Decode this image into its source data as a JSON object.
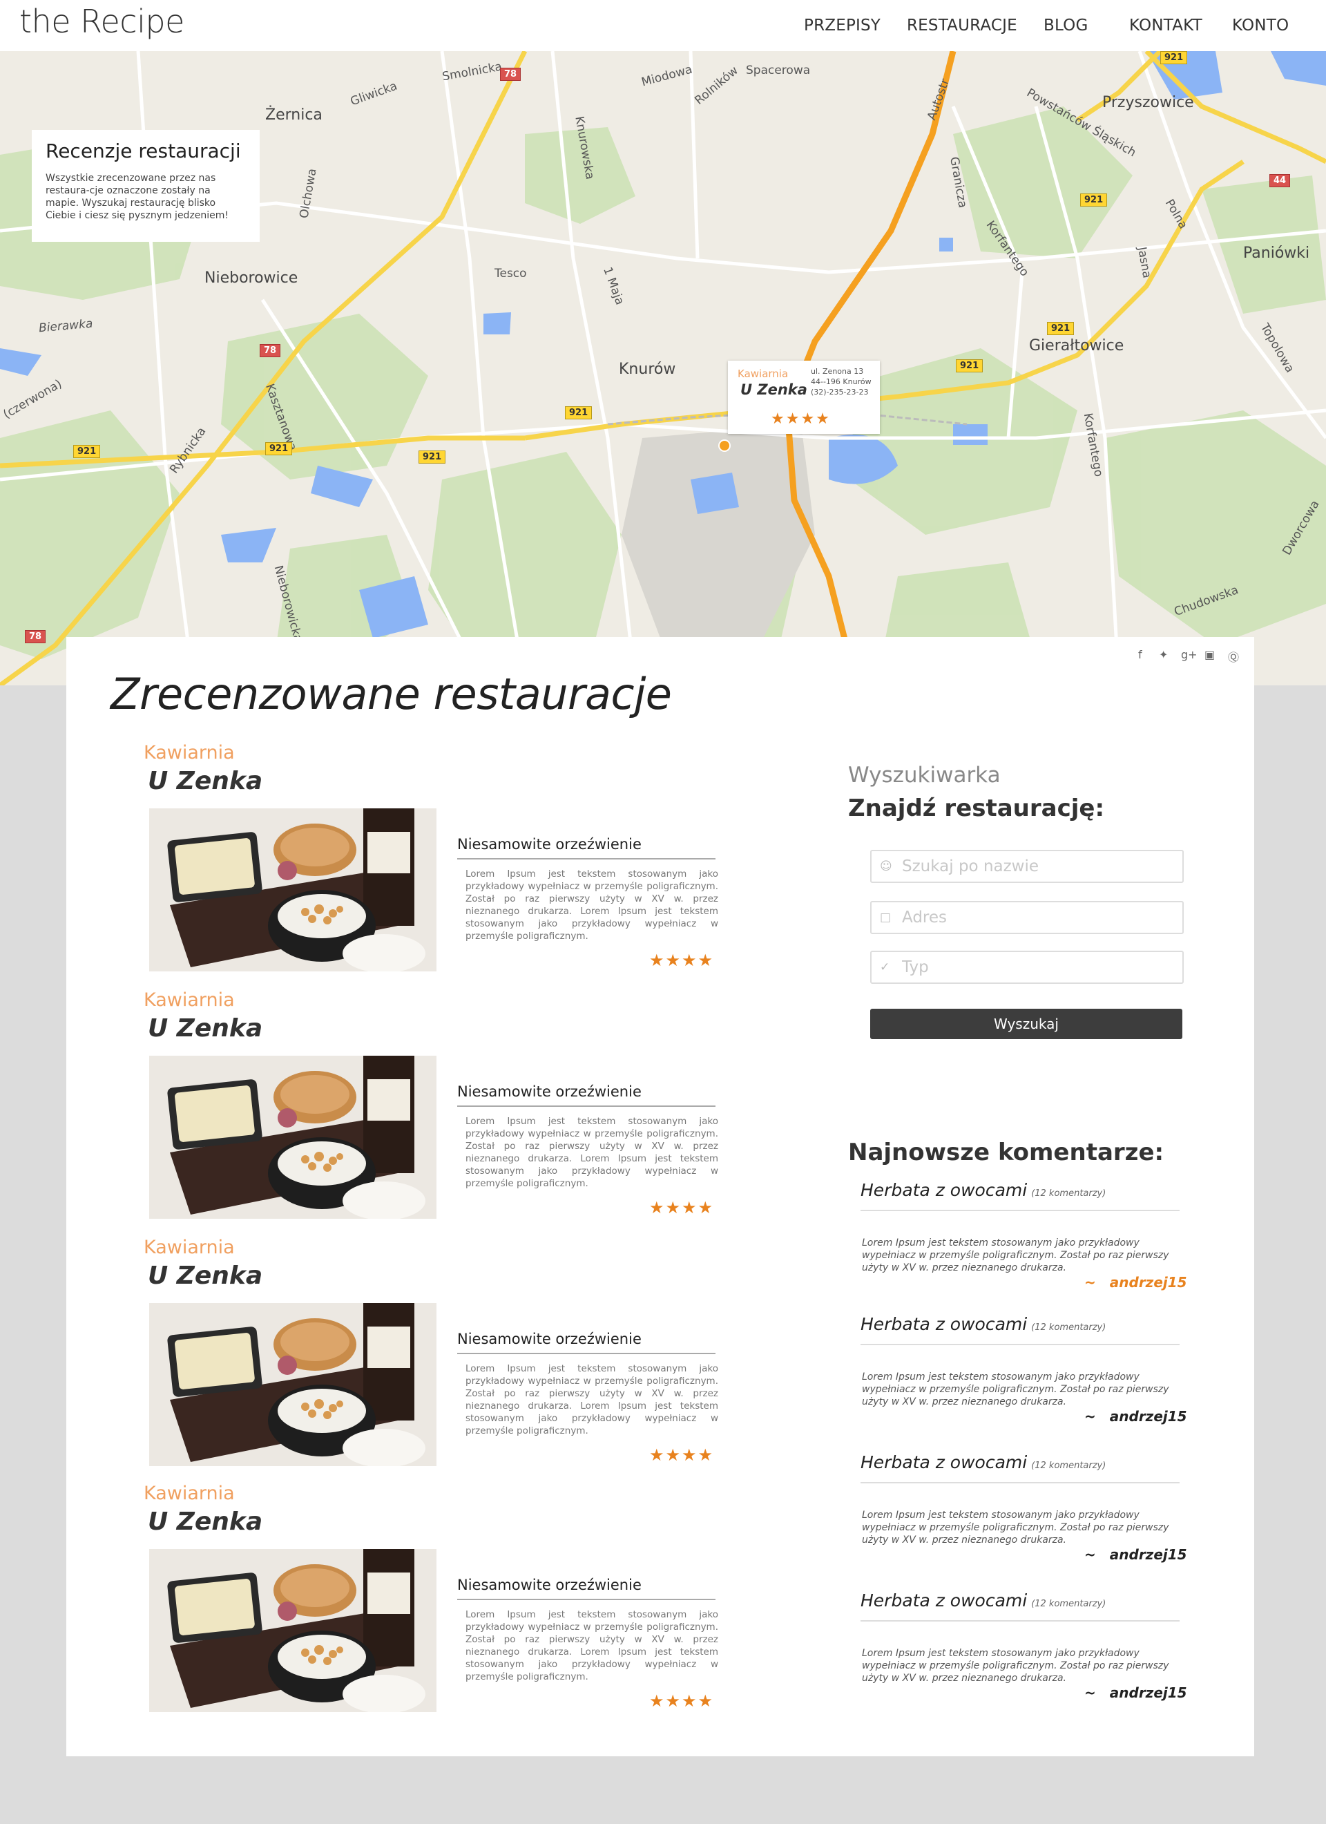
{
  "header": {
    "logo": "the Recipe",
    "nav": [
      "PRZEPISY",
      "RESTAURACJE",
      "BLOG",
      "KONTAKT",
      "KONTO"
    ]
  },
  "map": {
    "card_title": "Recenzje restauracji",
    "card_text": "Wszystkie zrecenzowane przez nas restaura-cje oznaczone zostały na mapie. Wyszukaj restaurację blisko Ciebie i ciesz się pysznym jedzeniem!",
    "labels": {
      "zernica": "Żernica",
      "nieborowice": "Nieborowice",
      "knurow": "Knurów",
      "przyszowice": "Przyszowice",
      "gieraltowice": "Gierałtowice",
      "paniowki": "Paniówki",
      "bierawka": "Bierawka",
      "tesco": "Tesco",
      "smolnicka": "Smolnicka",
      "gliwicka": "Gliwicka",
      "miodowa": "Miodowa",
      "rolnikow": "Rolników",
      "spacerowa": "Spacerowa",
      "knurowska": "Knurowska",
      "autostrada": "Autostr",
      "korfantego": "Korfantego",
      "chudowska": "Chudowska",
      "rybnicka": "Rybnicka",
      "olchowa": "Olchowa",
      "jasna": "Jasna",
      "polna": "Polna",
      "topolowa": "Topolowa",
      "dworcowa": "Dworcowa",
      "kasztanowa": "Kasztanowa",
      "nieborowicka": "Nieborowicka",
      "czerwona": "(czerwona)",
      "powstancow": "Powstańców Śląskich",
      "grunwaldzka": "Granicza",
      "maja": "1 Maja"
    },
    "road_numbers": {
      "r921": "921",
      "r78": "78",
      "r44": "44"
    },
    "pin": {
      "type": "Kawiarnia",
      "name": "U Zenka",
      "address_line1": "ul. Zenona 13",
      "address_line2": "44--196 Knurów",
      "phone": "(32)-235-23-23",
      "stars": "★★★★",
      "rating": 4
    }
  },
  "social_icons": [
    "facebook-icon",
    "twitter-icon",
    "google-plus-icon",
    "instagram-icon",
    "pinterest-icon"
  ],
  "main": {
    "title": "Zrecenzowane restauracje",
    "reviews": [
      {
        "type": "Kawiarnia",
        "name": "U Zenka",
        "headline": "Niesamowite orzeźwienie",
        "text": "Lorem Ipsum jest tekstem stosowanym jako przykładowy wypełniacz w przemyśle poligraficznym. Został po raz pierwszy użyty w XV w. przez nieznanego drukarza. Lorem Ipsum jest tekstem stosowanym jako przykładowy wypełniacz w przemyśle poligraficznym.",
        "stars": "★★★★",
        "rating": 4
      },
      {
        "type": "Kawiarnia",
        "name": "U Zenka",
        "headline": "Niesamowite orzeźwienie",
        "text": "Lorem Ipsum jest tekstem stosowanym jako przykładowy wypełniacz w przemyśle poligraficznym. Został po raz pierwszy użyty w XV w. przez nieznanego drukarza. Lorem Ipsum jest tekstem stosowanym jako przykładowy wypełniacz w przemyśle poligraficznym.",
        "stars": "★★★★",
        "rating": 4
      },
      {
        "type": "Kawiarnia",
        "name": "U Zenka",
        "headline": "Niesamowite orzeźwienie",
        "text": "Lorem Ipsum jest tekstem stosowanym jako przykładowy wypełniacz w przemyśle poligraficznym. Został po raz pierwszy użyty w XV w. przez nieznanego drukarza. Lorem Ipsum jest tekstem stosowanym jako przykładowy wypełniacz w przemyśle poligraficznym.",
        "stars": "★★★★",
        "rating": 4
      },
      {
        "type": "Kawiarnia",
        "name": "U Zenka",
        "headline": "Niesamowite orzeźwienie",
        "text": "Lorem Ipsum jest tekstem stosowanym jako przykładowy wypełniacz w przemyśle poligraficznym. Został po raz pierwszy użyty w XV w. przez nieznanego drukarza. Lorem Ipsum jest tekstem stosowanym jako przykładowy wypełniacz w przemyśle poligraficznym.",
        "stars": "★★★★",
        "rating": 4
      }
    ]
  },
  "sidebar": {
    "search_subtitle": "Wyszukiwarka",
    "search_title": "Znajdź restaurację:",
    "name_placeholder": "Szukaj po nazwie",
    "address_placeholder": "Adres",
    "type_placeholder": "Typ",
    "search_button": "Wyszukaj",
    "comments_title": "Najnowsze komentarze:",
    "comments": [
      {
        "title": "Herbata z owocami",
        "count": "(12 komentarzy)",
        "text": "Lorem Ipsum jest tekstem stosowanym jako przykładowy wypełniacz w przemyśle poligraficznym. Został po raz pierwszy użyty w XV w. przez nieznanego drukarza.",
        "tilde": "~",
        "author": "andrzej15"
      },
      {
        "title": "Herbata z owocami",
        "count": "(12 komentarzy)",
        "text": "Lorem Ipsum jest tekstem stosowanym jako przykładowy wypełniacz w przemyśle poligraficznym. Został po raz pierwszy użyty w XV w. przez nieznanego drukarza.",
        "tilde": "~",
        "author": "andrzej15"
      },
      {
        "title": "Herbata z owocami",
        "count": "(12 komentarzy)",
        "text": "Lorem Ipsum jest tekstem stosowanym jako przykładowy wypełniacz w przemyśle poligraficznym. Został po raz pierwszy użyty w XV w. przez nieznanego drukarza.",
        "tilde": "~",
        "author": "andrzej15"
      },
      {
        "title": "Herbata z owocami",
        "count": "(12 komentarzy)",
        "text": "Lorem Ipsum jest tekstem stosowanym jako przykładowy wypełniacz w przemyśle poligraficznym. Został po raz pierwszy użyty w XV w. przez nieznanego drukarza.",
        "tilde": "~",
        "author": "andrzej15"
      }
    ]
  },
  "colors": {
    "accent": "#e8821e",
    "type_label": "#f0a060",
    "button": "#3d3d3d",
    "background": "#dcdcdc"
  }
}
